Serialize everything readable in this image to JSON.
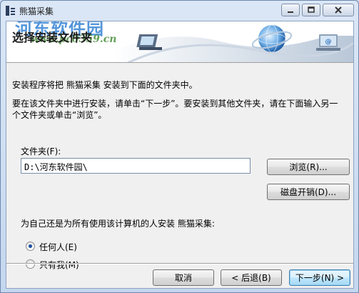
{
  "window": {
    "title": "熊猫采集"
  },
  "watermark": {
    "text": "河东软件园",
    "url": "www.pc0359.cn"
  },
  "banner": {
    "heading": "选择安装文件夹"
  },
  "body": {
    "intro": "安装程序将把 熊猫采集 安装到下面的文件夹中。",
    "instruction_line1": "要在该文件夹中进行安装，请单击“下一步”。要安装到其他文件夹，请在下面输入另一",
    "instruction_line2": "个文件夹或单击“浏览”。",
    "folder_label": "文件夹(F):",
    "folder_value": "D:\\河东软件园\\",
    "browse_label": "浏览(R)...",
    "disk_cost_label": "磁盘开销(D)...",
    "install_for_question": "为自己还是为所有使用该计算机的人安装 熊猫采集:",
    "option_everyone": "任何人(E)",
    "option_just_me": "只有我(M)",
    "selected_option": "everyone"
  },
  "footer": {
    "cancel_label": "取消",
    "back_label": "< 后退(B)",
    "next_label": "下一步(N) >"
  }
}
